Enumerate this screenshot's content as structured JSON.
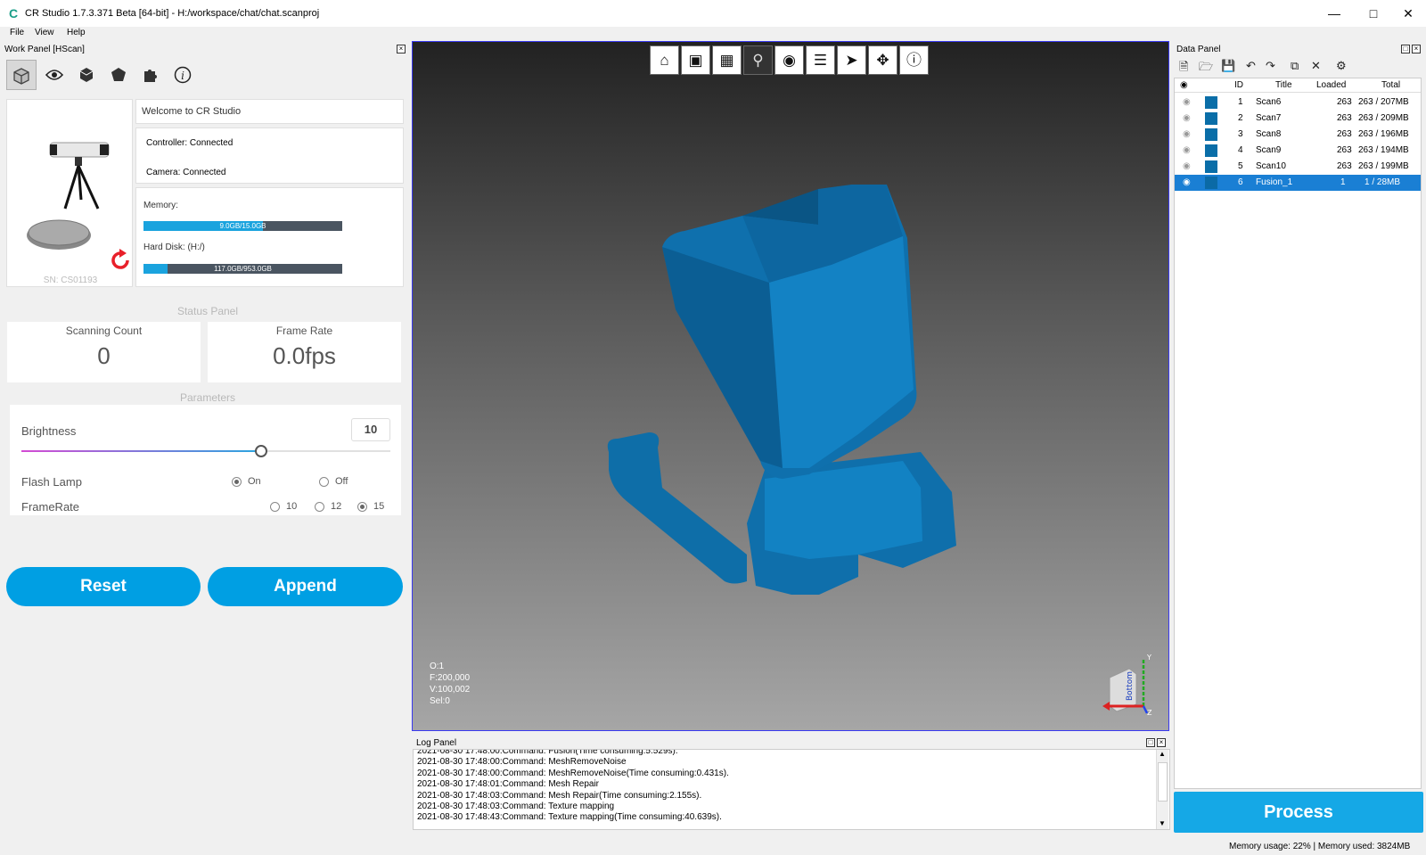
{
  "app": {
    "title": "CR Studio 1.7.3.371 Beta [64-bit] - H:/workspace/chat/chat.scanproj",
    "window_controls": [
      "minimize-icon",
      "maximize-icon",
      "close-icon"
    ]
  },
  "menu": [
    "File",
    "View",
    "Help"
  ],
  "work_panel": {
    "title": "Work Panel [HScan]",
    "tools": [
      "scan-cube-icon",
      "eye-icon",
      "cube-icon",
      "polyhedron-icon",
      "puzzle-icon",
      "info-icon"
    ],
    "serial": "SN: CS01193",
    "welcome": "Welcome to CR Studio",
    "controller": "Controller: Connected",
    "camera": "Camera: Connected",
    "memory_label": "Memory:",
    "memory_text": "9.0GB/15.0GB",
    "memory_used_fraction": 0.6,
    "disk_label": "Hard Disk: (H:/)",
    "disk_text": "117.0GB/953.0GB",
    "disk_used_fraction": 0.123
  },
  "status_panel": {
    "title": "Status Panel",
    "scan_count_label": "Scanning Count",
    "scan_count": "0",
    "frame_rate_label": "Frame Rate",
    "frame_rate": "0.0fps"
  },
  "parameters": {
    "title": "Parameters",
    "brightness_label": "Brightness",
    "brightness": "10",
    "brightness_level": 0.65,
    "flash_label": "Flash Lamp",
    "flash_on": "On",
    "flash_off": "Off",
    "flash_selected": "On",
    "framerate_label": "FrameRate",
    "framerate_options": [
      "10",
      "12",
      "15"
    ],
    "framerate_selected": "15"
  },
  "buttons": {
    "reset": "Reset",
    "append": "Append",
    "process": "Process"
  },
  "viewport": {
    "tools": [
      "home-icon",
      "fit-view-icon",
      "mesh-view-icon",
      "light-bulb-icon",
      "eye-icon",
      "layers-icon",
      "pointer-icon",
      "move-icon",
      "info-icon"
    ],
    "stats": [
      "O:1",
      "F:200,000",
      "V:100,002",
      "Sel:0"
    ],
    "orientation": "Bottom"
  },
  "log": {
    "title": "Log Panel",
    "lines": [
      "2021-08-30 17:48:00:Command: Fusion(Time consuming:5.529s).",
      "2021-08-30 17:48:00:Command: MeshRemoveNoise",
      "2021-08-30 17:48:00:Command: MeshRemoveNoise(Time consuming:0.431s).",
      "2021-08-30 17:48:01:Command: Mesh Repair",
      "2021-08-30 17:48:03:Command: Mesh Repair(Time consuming:2.155s).",
      "2021-08-30 17:48:03:Command: Texture mapping",
      "2021-08-30 17:48:43:Command: Texture mapping(Time consuming:40.639s)."
    ]
  },
  "data_panel": {
    "title": "Data Panel",
    "tools": [
      "new-file-icon",
      "open-folder-icon",
      "save-icon",
      "undo-icon",
      "redo-icon",
      "copy-icon",
      "delete-icon",
      "settings-icon"
    ],
    "columns": [
      "ID",
      "Title",
      "Loaded",
      "Total"
    ],
    "rows": [
      {
        "id": "1",
        "title": "Scan6",
        "loaded": "263",
        "total": "263 / 207MB"
      },
      {
        "id": "2",
        "title": "Scan7",
        "loaded": "263",
        "total": "263 / 209MB"
      },
      {
        "id": "3",
        "title": "Scan8",
        "loaded": "263",
        "total": "263 / 196MB"
      },
      {
        "id": "4",
        "title": "Scan9",
        "loaded": "263",
        "total": "263 / 194MB"
      },
      {
        "id": "5",
        "title": "Scan10",
        "loaded": "263",
        "total": "263 / 199MB"
      },
      {
        "id": "6",
        "title": "Fusion_1",
        "loaded": "1",
        "total": "1 / 28MB"
      }
    ],
    "selected_row": 5
  },
  "statusbar": "Memory usage: 22% | Memory used: 3824MB"
}
